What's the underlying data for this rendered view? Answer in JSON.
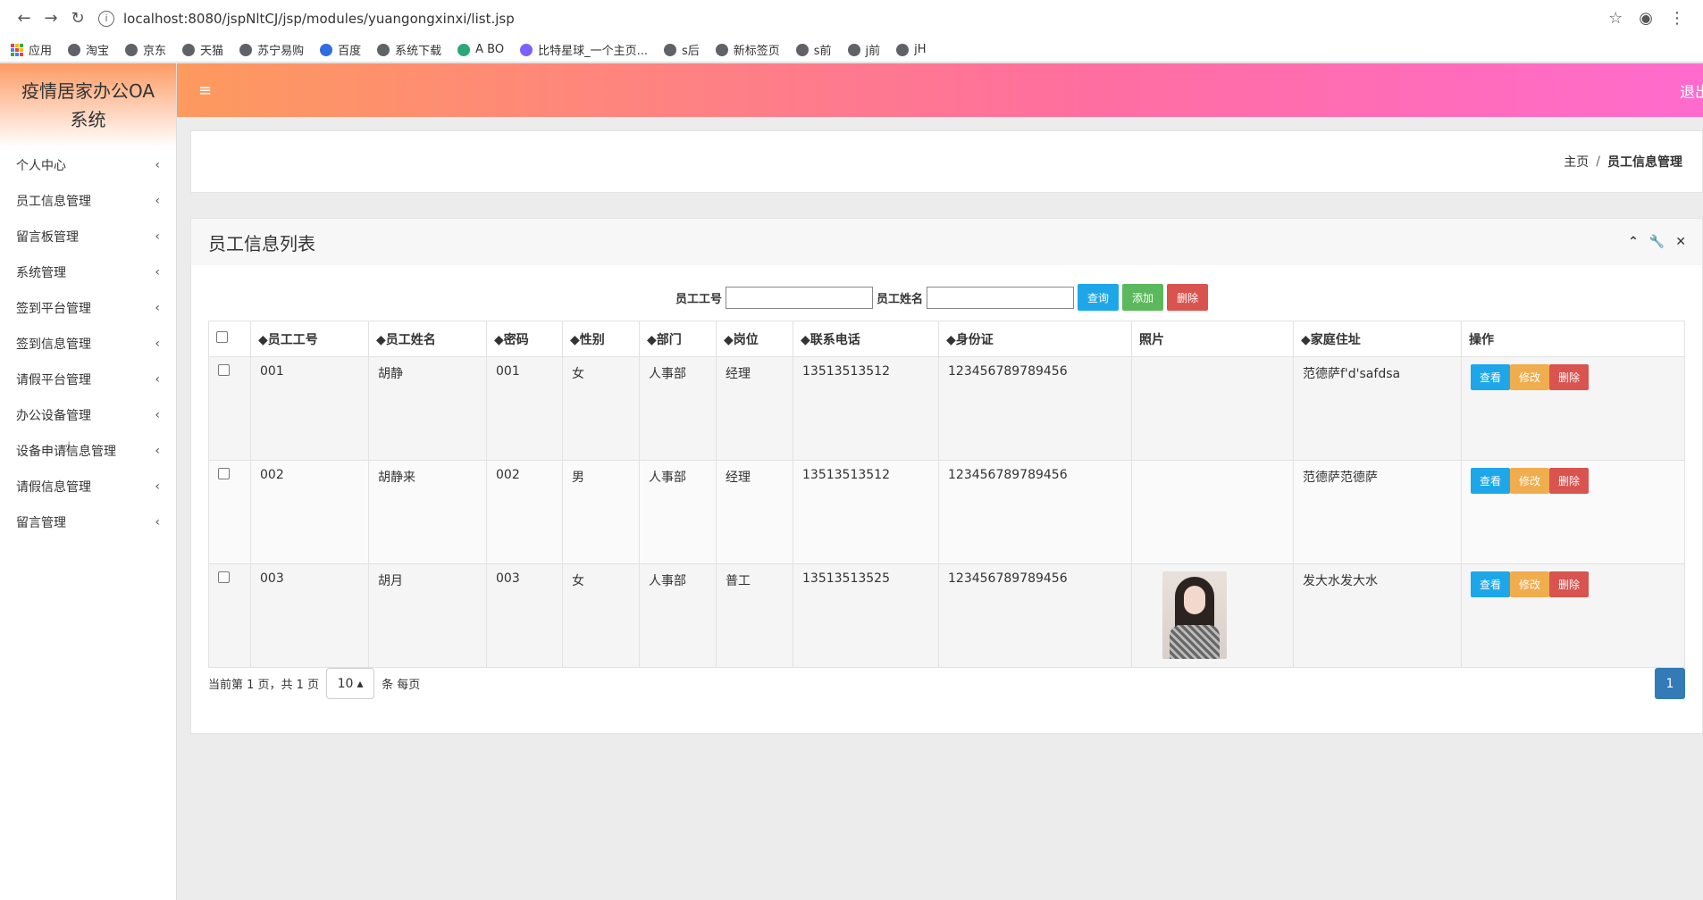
{
  "browser": {
    "url": "localhost:8080/jspNltCJ/jsp/modules/yuangongxinxi/list.jsp",
    "bookmarks": [
      "应用",
      "淘宝",
      "京东",
      "天猫",
      "苏宁易购",
      "百度",
      "系统下载",
      "A BO",
      "比特星球_一个主页...",
      "s后",
      "新标签页",
      "s前",
      "j前",
      "jH"
    ]
  },
  "app": {
    "title": "疫情居家办公OA系统",
    "logout": "退出",
    "menu": [
      "个人中心",
      "员工信息管理",
      "留言板管理",
      "系统管理",
      "签到平台管理",
      "签到信息管理",
      "请假平台管理",
      "办公设备管理",
      "设备申请信息管理",
      "请假信息管理",
      "留言管理"
    ]
  },
  "breadcrumb": {
    "home": "主页",
    "separator": "/",
    "current": "员工信息管理"
  },
  "panel": {
    "title": "员工信息列表",
    "search": {
      "label_id": "员工工号",
      "label_name": "员工姓名",
      "query": "查询",
      "add": "添加",
      "delete": "删除"
    },
    "columns": [
      "◆员工工号",
      "◆员工姓名",
      "◆密码",
      "◆性别",
      "◆部门",
      "◆岗位",
      "◆联系电话",
      "◆身份证",
      "照片",
      "◆家庭住址",
      "操作"
    ],
    "rows": [
      {
        "id": "001",
        "name": "胡静",
        "password": "001",
        "gender": "女",
        "dept": "人事部",
        "post": "经理",
        "phone": "13513513512",
        "idcard": "123456789789456",
        "address": "范德萨f'd'safdsa"
      },
      {
        "id": "002",
        "name": "胡静来",
        "password": "002",
        "gender": "男",
        "dept": "人事部",
        "post": "经理",
        "phone": "13513513512",
        "idcard": "123456789789456",
        "address": "范德萨范德萨"
      },
      {
        "id": "003",
        "name": "胡月",
        "password": "003",
        "gender": "女",
        "dept": "人事部",
        "post": "普工",
        "phone": "13513513525",
        "idcard": "123456789789456",
        "address": "发大水发大水"
      }
    ],
    "actions": {
      "view": "查看",
      "edit": "修改",
      "delete": "删除"
    },
    "footer": {
      "info": "当前第 1 页，共 1 页",
      "page_size": "10",
      "per_page": "条 每页",
      "page": "1"
    }
  }
}
